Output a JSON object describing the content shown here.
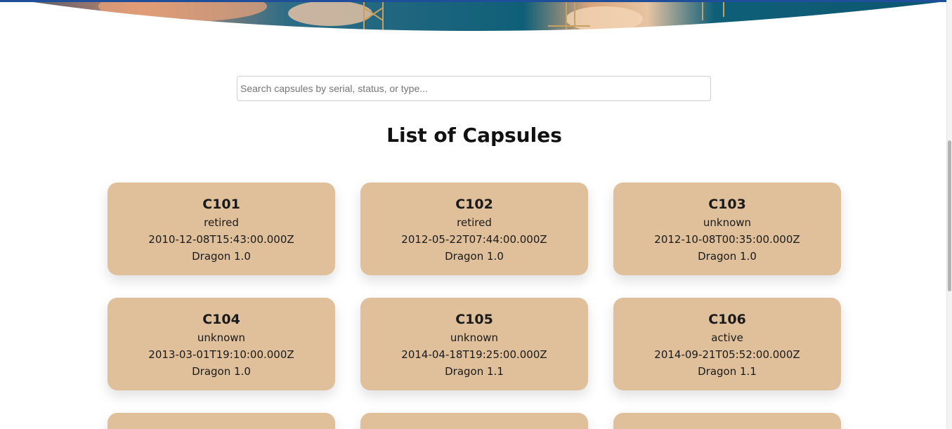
{
  "search": {
    "placeholder": "Search capsules by serial, status, or type...",
    "value": ""
  },
  "page": {
    "title": "List of Capsules"
  },
  "colors": {
    "card_background": "#dfc09a",
    "top_strip": "#1f4f9a",
    "hero_sky": "#0e5a72"
  },
  "capsules": [
    {
      "serial": "C101",
      "status": "retired",
      "launch": "2010-12-08T15:43:00.000Z",
      "type": "Dragon 1.0"
    },
    {
      "serial": "C102",
      "status": "retired",
      "launch": "2012-05-22T07:44:00.000Z",
      "type": "Dragon 1.0"
    },
    {
      "serial": "C103",
      "status": "unknown",
      "launch": "2012-10-08T00:35:00.000Z",
      "type": "Dragon 1.0"
    },
    {
      "serial": "C104",
      "status": "unknown",
      "launch": "2013-03-01T19:10:00.000Z",
      "type": "Dragon 1.0"
    },
    {
      "serial": "C105",
      "status": "unknown",
      "launch": "2014-04-18T19:25:00.000Z",
      "type": "Dragon 1.1"
    },
    {
      "serial": "C106",
      "status": "active",
      "launch": "2014-09-21T05:52:00.000Z",
      "type": "Dragon 1.1"
    }
  ]
}
